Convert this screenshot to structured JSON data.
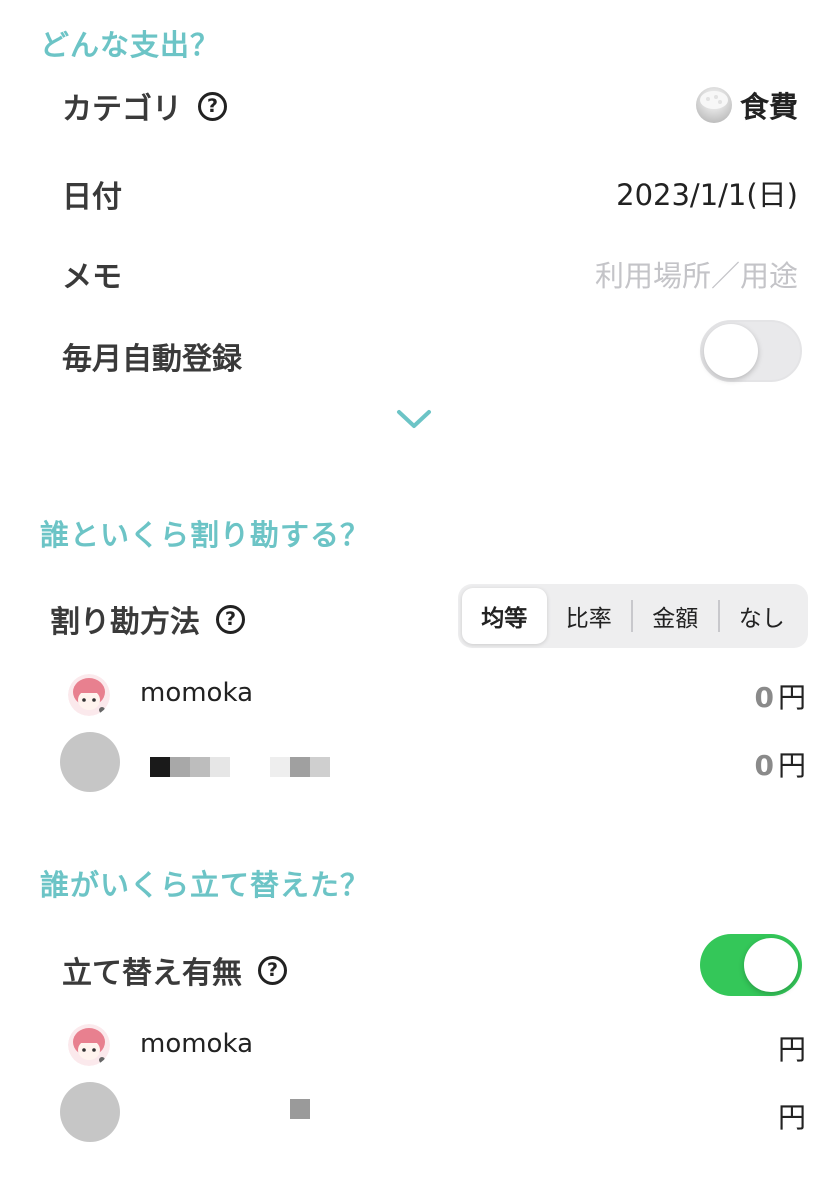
{
  "expense_section": {
    "title": "どんな支出？",
    "category": {
      "label": "カテゴリ",
      "value": "食費",
      "icon": "rice-bowl-icon"
    },
    "date": {
      "label": "日付",
      "value": "2023/1/1(日)"
    },
    "memo": {
      "label": "メモ",
      "placeholder": "利用場所／用途"
    },
    "monthly_auto": {
      "label": "毎月自動登録",
      "on": false
    }
  },
  "split_section": {
    "title": "誰といくら割り勘する？",
    "method_label": "割り勘方法",
    "methods": [
      "均等",
      "比率",
      "金額",
      "なし"
    ],
    "selected_method": "均等",
    "members": [
      {
        "name": "momoka",
        "amount": "0",
        "unit": "円",
        "avatar": "anime-avatar"
      },
      {
        "name": "",
        "amount": "0",
        "unit": "円",
        "avatar": "grey-avatar"
      }
    ]
  },
  "advance_section": {
    "title": "誰がいくら立て替えた？",
    "toggle_label": "立て替え有無",
    "toggle_on": true,
    "members": [
      {
        "name": "momoka",
        "amount": "",
        "unit": "円",
        "avatar": "anime-avatar"
      },
      {
        "name": "",
        "amount": "",
        "unit": "円",
        "avatar": "grey-avatar"
      }
    ]
  },
  "colors": {
    "accent": "#6cc4c6",
    "toggle_on": "#34c759",
    "toggle_off": "#e9e9eb",
    "placeholder": "#c4c4c8"
  }
}
